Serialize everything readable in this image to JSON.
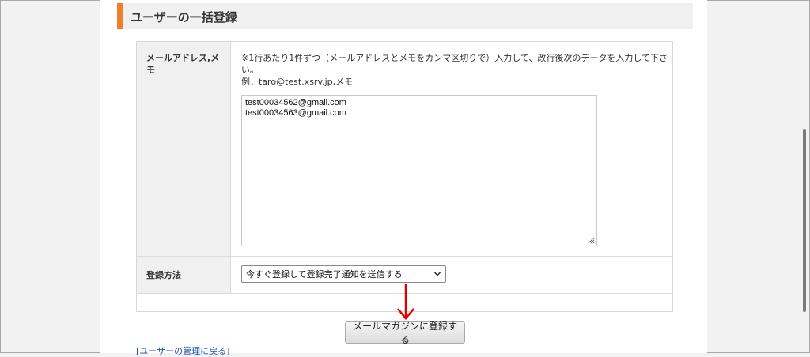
{
  "section": {
    "title": "ユーザーの一括登録"
  },
  "form": {
    "email_label": "メールアドレス,メ\nモ",
    "email_desc_line1": "※1行あたり1件ずつ（メールアドレスとメモをカンマ区切りで）入力して、改行後次のデータを入力して下さ",
    "email_desc_line2": "い。",
    "email_example": "例．taro@test.xsrv.jp,メモ",
    "textarea_lines": [
      "test00034562@gmail.com",
      "test00034563@gmail.com"
    ],
    "method_label": "登録方法",
    "method_selected": "今すぐ登録して登録完了通知を送信する"
  },
  "submit": {
    "label": "メールマガジンに登録する"
  },
  "back_link": {
    "label": "[ユーザーの管理に戻る]"
  },
  "colors": {
    "accent": "#f07f2e",
    "annotation_arrow": "#e00000",
    "link": "#1a4fb0"
  },
  "icons": {
    "select_chevron": "chevron-down-icon",
    "textarea_resize": "resize-grip-icon",
    "annotation": "arrow-down-icon"
  }
}
